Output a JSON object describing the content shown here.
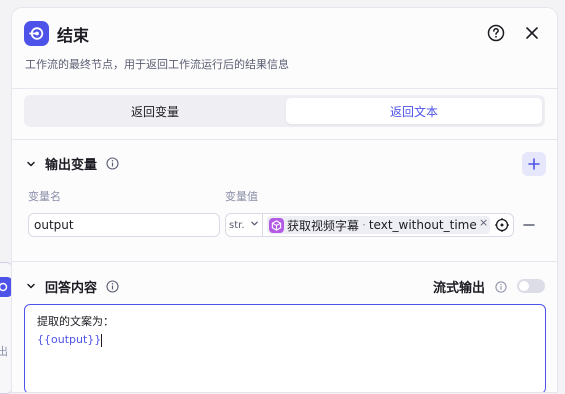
{
  "background_node": {
    "partial_label": "出"
  },
  "header": {
    "title": "结束",
    "description": "工作流的最终节点，用于返回工作流运行后的结果信息"
  },
  "tabs": [
    {
      "label": "返回变量",
      "active": false
    },
    {
      "label": "返回文本",
      "active": true
    }
  ],
  "output_section": {
    "title": "输出变量",
    "columns": {
      "name": "变量名",
      "value": "变量值"
    },
    "rows": [
      {
        "name": "output",
        "type": "str.",
        "source_node": "获取视频字幕",
        "source_separator": "·",
        "source_field": "text_without_time",
        "clear_label": "×"
      }
    ]
  },
  "answer_section": {
    "title": "回答内容",
    "stream_label": "流式输出",
    "stream_enabled": false,
    "content_line1": "提取的文案为：",
    "content_var": "{{output}}"
  },
  "colors": {
    "accent": "#4d53e8",
    "ref_icon": "#b45be5",
    "border": "#e6e6ee"
  },
  "icons": [
    "end-node-icon",
    "help-icon",
    "close-icon",
    "chevron-down-icon",
    "info-icon",
    "plus-icon",
    "cube-icon",
    "target-icon",
    "minus-icon"
  ]
}
